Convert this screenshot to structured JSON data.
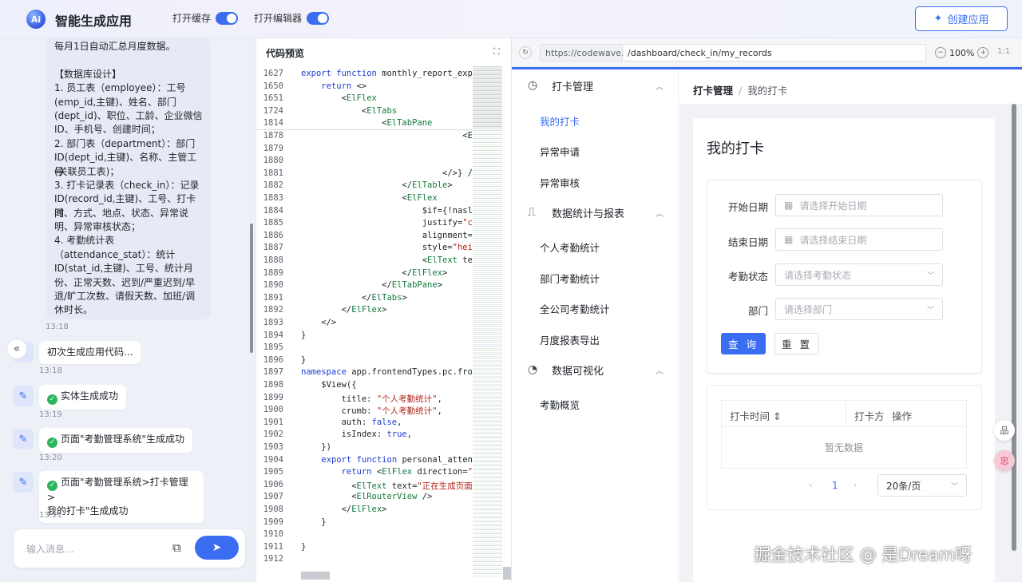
{
  "app": {
    "logo_text": "Ai",
    "title": "智能生成应用",
    "toggle_cache": "打开缓存",
    "toggle_editor": "打开编辑器",
    "create_button": "创建应用"
  },
  "chat": {
    "db_message": {
      "lines": [
        "每月1日自动汇总月度数据。",
        "",
        "【数据库设计】",
        "1. 员工表（employee）：工号",
        "(emp_id,主键)、姓名、部门",
        "(dept_id)、职位、工龄、企业微信",
        "ID、手机号、创建时间；",
        "2. 部门表（department）：部门",
        "ID(dept_id,主键)、名称、主管工号",
        "(关联员工表)；",
        "3. 打卡记录表（check_in）：记录",
        "ID(record_id,主键)、工号、打卡时",
        "间、方式、地点、状态、异常说",
        "明、异常审核状态；",
        "4. 考勤统计表",
        "（attendance_stat）：统计",
        "ID(stat_id,主键)、工号、统计月",
        "份、正常天数、迟到/严重迟到/早",
        "退/旷工次数、请假天数、加班/调",
        "休时长。"
      ],
      "time": "13:18"
    },
    "messages": [
      {
        "text": "初次生成应用代码...",
        "time": "13:18",
        "success": false
      },
      {
        "text": "实体生成成功",
        "time": "13:19",
        "success": true
      },
      {
        "text": "页面\"考勤管理系统\"生成成功",
        "time": "13:20",
        "success": true
      },
      {
        "text": "页面\"考勤管理系统>打卡管理>",
        "text2": "我的打卡\"生成成功",
        "time": "13:21",
        "success": true
      }
    ],
    "input_placeholder": "输入消息..."
  },
  "code": {
    "title": "代码预览",
    "lines": [
      {
        "n": "1627",
        "t": "export function monthly_report_exp"
      },
      {
        "n": "1650",
        "t": "    return <>"
      },
      {
        "n": "1651",
        "t": "        <ElFlex"
      },
      {
        "n": "1724",
        "t": "            <ElTabs"
      },
      {
        "n": "1814",
        "t": "                <ElTabPane"
      },
      {
        "n": "1878",
        "t": "                                <E"
      },
      {
        "n": "1879",
        "t": ""
      },
      {
        "n": "1880",
        "t": ""
      },
      {
        "n": "1881",
        "t": "                            </>} /"
      },
      {
        "n": "1882",
        "t": "                    </ElTable>"
      },
      {
        "n": "1883",
        "t": "                    <ElFlex"
      },
      {
        "n": "1884",
        "t": "                        $if={!nasl"
      },
      {
        "n": "1885",
        "t": "                        justify=\"c"
      },
      {
        "n": "1886",
        "t": "                        alignment="
      },
      {
        "n": "1887",
        "t": "                        style=\"hei"
      },
      {
        "n": "1888",
        "t": "                        <ElText te"
      },
      {
        "n": "1889",
        "t": "                    </ElFlex>"
      },
      {
        "n": "1890",
        "t": "                </ElTabPane>"
      },
      {
        "n": "1891",
        "t": "            </ElTabs>"
      },
      {
        "n": "1892",
        "t": "        </ElFlex>"
      },
      {
        "n": "1893",
        "t": "    </>"
      },
      {
        "n": "1894",
        "t": "}"
      },
      {
        "n": "1895",
        "t": ""
      },
      {
        "n": "1896",
        "t": "}"
      },
      {
        "n": "1897",
        "t": "namespace app.frontendTypes.pc.fro"
      },
      {
        "n": "1898",
        "t": "    $View({"
      },
      {
        "n": "1899",
        "t": "        title: \"个人考勤统计\","
      },
      {
        "n": "1900",
        "t": "        crumb: \"个人考勤统计\","
      },
      {
        "n": "1901",
        "t": "        auth: false,"
      },
      {
        "n": "1902",
        "t": "        isIndex: true,"
      },
      {
        "n": "1903",
        "t": "    })"
      },
      {
        "n": "1904",
        "t": "    export function personal_attend"
      },
      {
        "n": "1905",
        "t": "        return <ElFlex direction=\""
      },
      {
        "n": "1906",
        "t": "          <ElText text=\"正在生成页面"
      },
      {
        "n": "1907",
        "t": "          <ElRouterView />"
      },
      {
        "n": "1908",
        "t": "        </ElFlex>"
      },
      {
        "n": "1909",
        "t": "    }"
      },
      {
        "n": "1910",
        "t": ""
      },
      {
        "n": "1911",
        "t": "}"
      },
      {
        "n": "1912",
        "t": ""
      }
    ]
  },
  "preview": {
    "url_host": "https://codewave.ai",
    "url_path": "/dashboard/check_in/my_records",
    "zoom": "100%",
    "ratio": "1:1",
    "accent": "#3b6df2",
    "sidebar": {
      "groups": [
        {
          "label": "打卡管理",
          "icon": "clock-icon",
          "items": [
            "我的打卡",
            "异常申请",
            "异常审核"
          ]
        },
        {
          "label": "数据统计与报表",
          "icon": "chart-icon",
          "items": [
            "个人考勤统计",
            "部门考勤统计",
            "全公司考勤统计",
            "月度报表导出"
          ]
        },
        {
          "label": "数据可视化",
          "icon": "pie-icon",
          "items": [
            "考勤概览"
          ]
        }
      ]
    },
    "breadcrumb": [
      "打卡管理",
      "我的打卡"
    ],
    "page_title": "我的打卡",
    "form": {
      "start_label": "开始日期",
      "start_placeholder": "请选择开始日期",
      "end_label": "结束日期",
      "end_placeholder": "请选择结束日期",
      "status_label": "考勤状态",
      "status_placeholder": "请选择考勤状态",
      "dept_label": "部门",
      "dept_placeholder": "请选择部门",
      "query": "查 询",
      "reset": "重 置"
    },
    "table": {
      "columns": [
        "打卡时间",
        "打卡方",
        "操作"
      ],
      "empty": "暂无数据"
    },
    "pager": {
      "page": "1",
      "size": "20条/页"
    },
    "float_buttons": [
      "品",
      "忠"
    ]
  },
  "watermark": "掘金技术社区 @ 是Dream呀"
}
